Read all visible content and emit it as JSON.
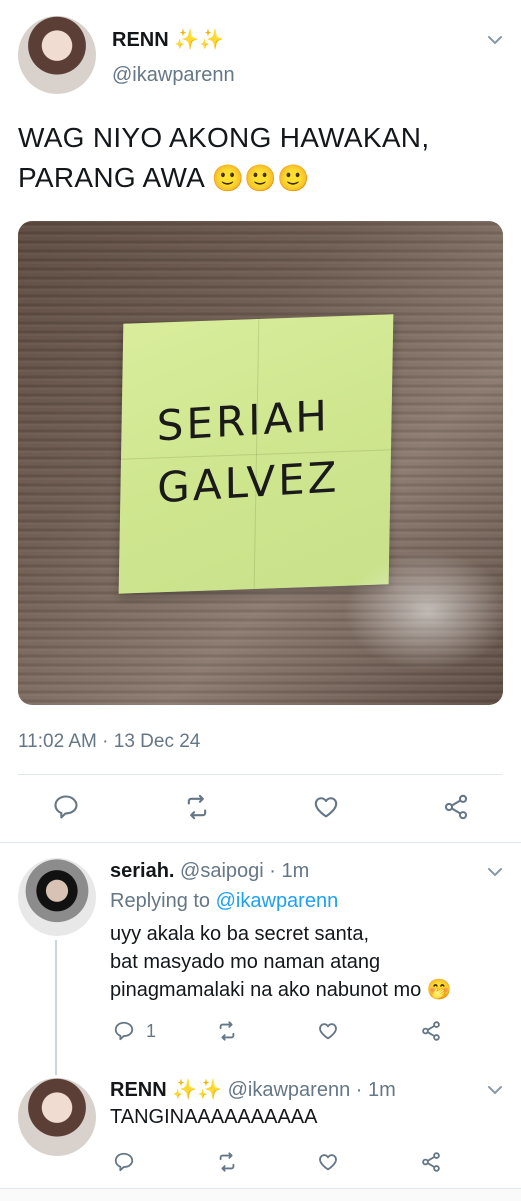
{
  "tweet": {
    "author_name": "RENN",
    "author_emoji": "✨✨",
    "handle": "@ikawparenn",
    "text_line1": "WAG NIYO AKONG HAWAKAN,",
    "text_line2": "PARANG AWA",
    "text_emojis": "🙂🙂🙂",
    "photo_text_line1": "SERIAH",
    "photo_text_line2": "GALVEZ",
    "timestamp": "11:02 AM · 13 Dec 24"
  },
  "replies": [
    {
      "name": "seriah.",
      "handle_time": "@saipogi · 1m",
      "replying_prefix": "Replying to ",
      "replying_to": "@ikawparenn",
      "body_line1": "uyy akala ko ba secret santa,",
      "body_line2": "bat masyado mo naman atang",
      "body_line3": "pinagmamalaki na ako nabunot mo 🤭",
      "reply_count": "1"
    },
    {
      "name": "RENN",
      "name_emoji": "✨✨",
      "handle_time": "@ikawparenn · 1m",
      "body": "TANGINAAAAAAAAAA"
    }
  ],
  "icons": [
    "chevron-down-icon",
    "reply-icon",
    "retweet-icon",
    "like-icon",
    "share-icon"
  ],
  "colors": {
    "link": "#1da1f2",
    "muted": "#657786",
    "emoji_star": "#f5c518"
  }
}
